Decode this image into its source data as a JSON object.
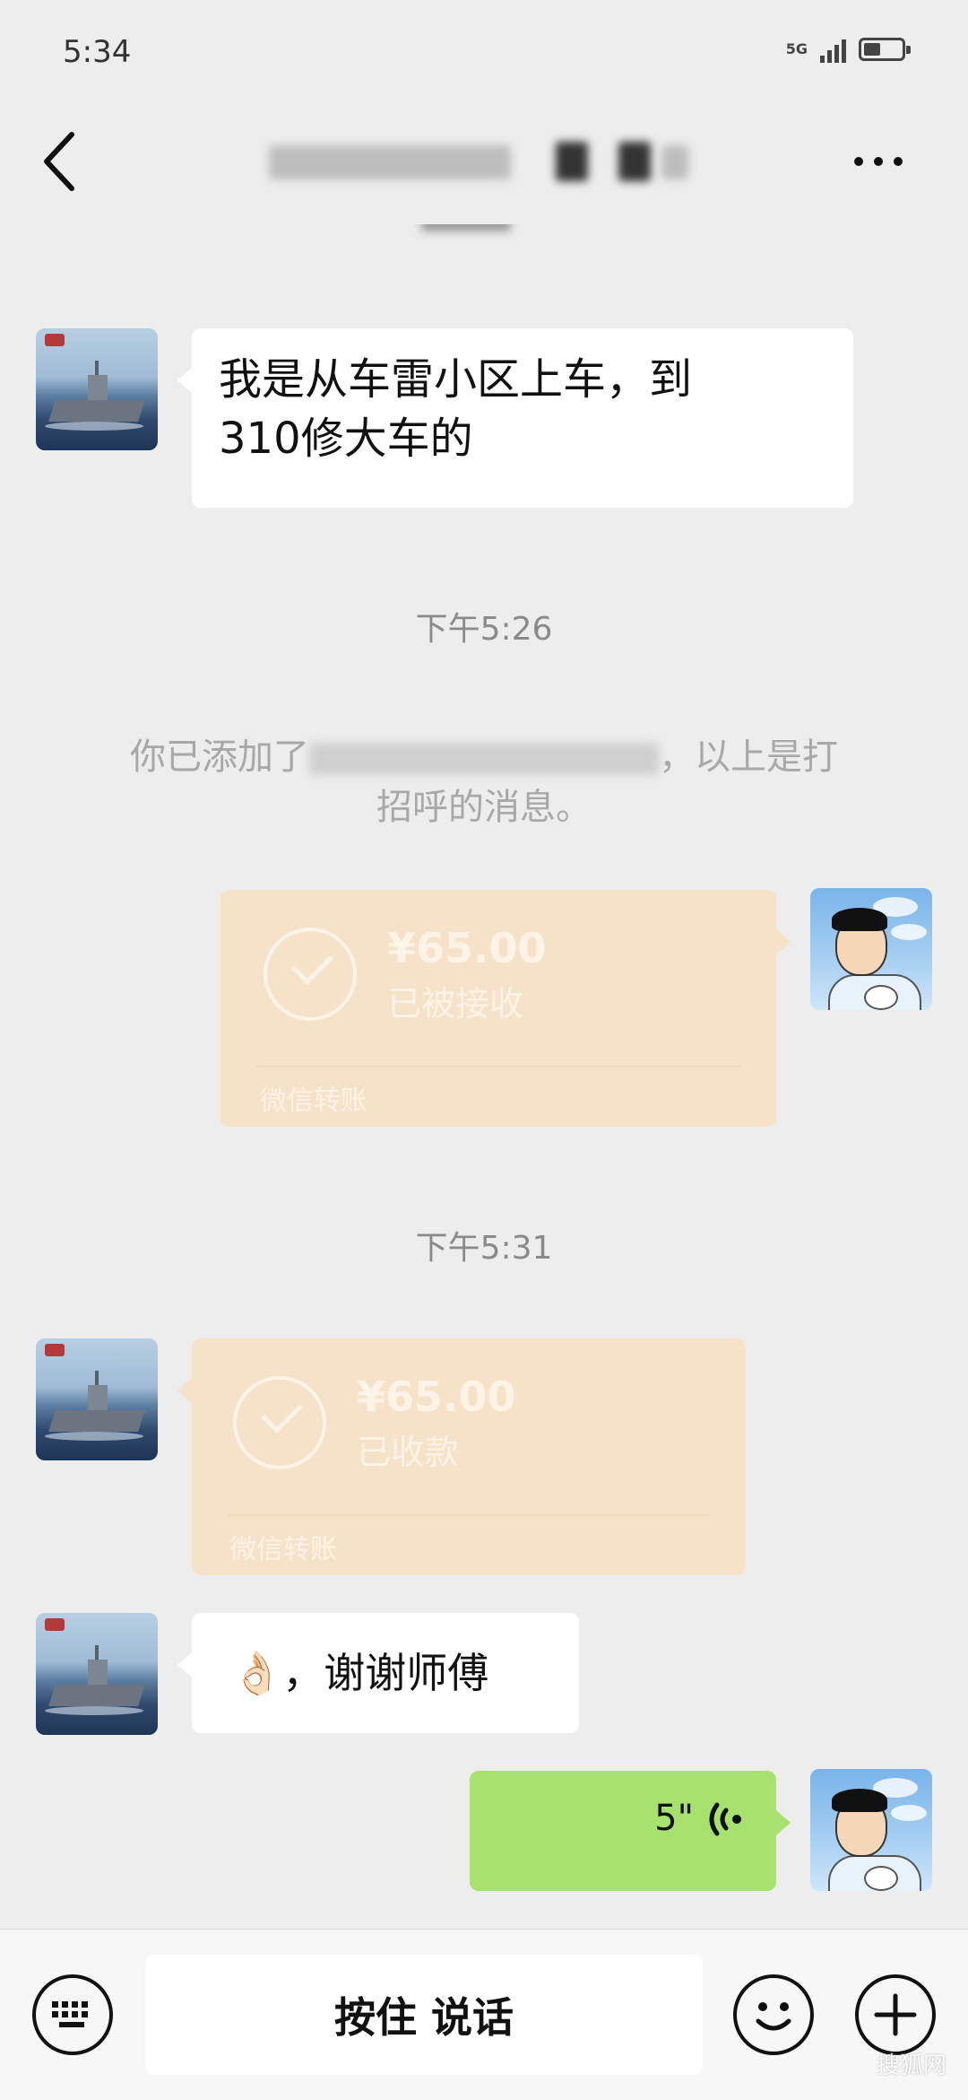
{
  "status_bar": {
    "time": "5:34",
    "network": "5G"
  },
  "header": {
    "title_blurred": true
  },
  "messages": {
    "msg1_text_line1": "我是从车雷小区上车，到",
    "msg1_text_line2": "310修大车的",
    "time1": "下午5:26",
    "system_prefix": "你已添加了",
    "system_suffix": "，以上是打",
    "system_line2": "招呼的消息。",
    "transfer_out": {
      "amount": "¥65.00",
      "status": "已被接收",
      "footer": "微信转账"
    },
    "time2": "下午5:31",
    "transfer_in": {
      "amount": "¥65.00",
      "status": "已收款",
      "footer": "微信转账"
    },
    "thanks_text": "👌🏻，谢谢师傅",
    "voice_duration": "5\""
  },
  "input_bar": {
    "hold_to_talk": "按住 说话"
  },
  "watermark": "搜狐网"
}
